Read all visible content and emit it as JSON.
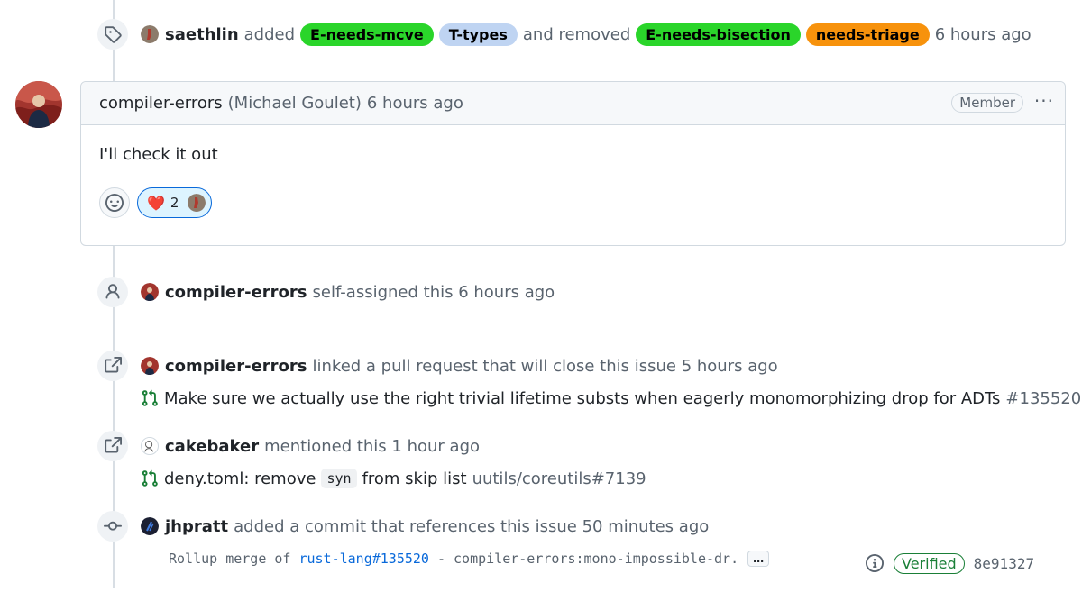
{
  "event_labels": {
    "actor": "saethlin",
    "verb_added": "added",
    "labels_added": [
      {
        "text": "E-needs-mcve",
        "bg": "#2ad52a",
        "fg": "#000000"
      },
      {
        "text": "T-types",
        "bg": "#bfd4f2",
        "fg": "#000000"
      }
    ],
    "verb_removed": "and removed",
    "labels_removed": [
      {
        "text": "E-needs-bisection",
        "bg": "#2ad52a",
        "fg": "#000000"
      },
      {
        "text": "needs-triage",
        "bg": "#f7920c",
        "fg": "#000000"
      }
    ],
    "time": "6 hours ago"
  },
  "comment": {
    "author": "compiler-errors",
    "full_name": "(Michael Goulet)",
    "time": "6 hours ago",
    "role_badge": "Member",
    "more_glyph": "···",
    "body": "I'll check it out",
    "reaction_emoji": "❤️",
    "reaction_count": "2"
  },
  "event_assign": {
    "actor": "compiler-errors",
    "text": "self-assigned this 6 hours ago"
  },
  "event_link_pr": {
    "actor": "compiler-errors",
    "text": "linked a pull request that will close this issue 5 hours ago",
    "pr_title": "Make sure we actually use the right trivial lifetime substs when eagerly monomorphizing drop for ADTs",
    "pr_ref": "#135520"
  },
  "event_mention": {
    "actor": "cakebaker",
    "text": "mentioned this 1 hour ago",
    "pr_title_before": "deny.toml: remove",
    "pr_code": "syn",
    "pr_title_after": "from skip list",
    "pr_ref": "uutils/coreutils#7139"
  },
  "event_commit": {
    "actor": "jhpratt",
    "text": "added a commit that references this issue 50 minutes ago",
    "msg_prefix": "Rollup merge of",
    "msg_link": "rust-lang#135520",
    "msg_suffix": "- compiler-errors:mono-impossible-dr.",
    "ellipsis": "…",
    "verified": "Verified",
    "sha": "8e91327"
  },
  "colors": {
    "accent_link": "#0969da",
    "verified_green": "#1a7f37",
    "pr_open_green": "#1a7f37"
  },
  "icons": [
    "tag-icon",
    "person-icon",
    "cross-reference-icon",
    "git-pull-request-icon",
    "git-commit-icon",
    "smiley-icon",
    "info-icon",
    "kebab-icon"
  ]
}
